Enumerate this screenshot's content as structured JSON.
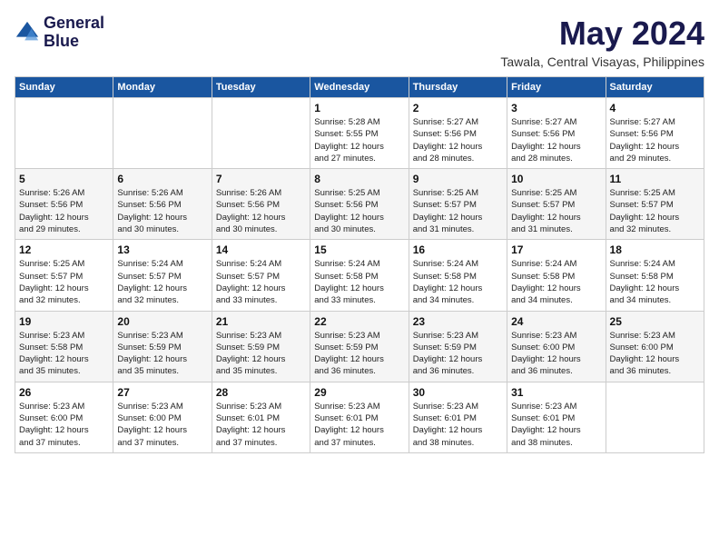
{
  "header": {
    "logo_line1": "General",
    "logo_line2": "Blue",
    "month": "May 2024",
    "location": "Tawala, Central Visayas, Philippines"
  },
  "weekdays": [
    "Sunday",
    "Monday",
    "Tuesday",
    "Wednesday",
    "Thursday",
    "Friday",
    "Saturday"
  ],
  "weeks": [
    [
      {
        "day": "",
        "content": ""
      },
      {
        "day": "",
        "content": ""
      },
      {
        "day": "",
        "content": ""
      },
      {
        "day": "1",
        "content": "Sunrise: 5:28 AM\nSunset: 5:55 PM\nDaylight: 12 hours\nand 27 minutes."
      },
      {
        "day": "2",
        "content": "Sunrise: 5:27 AM\nSunset: 5:56 PM\nDaylight: 12 hours\nand 28 minutes."
      },
      {
        "day": "3",
        "content": "Sunrise: 5:27 AM\nSunset: 5:56 PM\nDaylight: 12 hours\nand 28 minutes."
      },
      {
        "day": "4",
        "content": "Sunrise: 5:27 AM\nSunset: 5:56 PM\nDaylight: 12 hours\nand 29 minutes."
      }
    ],
    [
      {
        "day": "5",
        "content": "Sunrise: 5:26 AM\nSunset: 5:56 PM\nDaylight: 12 hours\nand 29 minutes."
      },
      {
        "day": "6",
        "content": "Sunrise: 5:26 AM\nSunset: 5:56 PM\nDaylight: 12 hours\nand 30 minutes."
      },
      {
        "day": "7",
        "content": "Sunrise: 5:26 AM\nSunset: 5:56 PM\nDaylight: 12 hours\nand 30 minutes."
      },
      {
        "day": "8",
        "content": "Sunrise: 5:25 AM\nSunset: 5:56 PM\nDaylight: 12 hours\nand 30 minutes."
      },
      {
        "day": "9",
        "content": "Sunrise: 5:25 AM\nSunset: 5:57 PM\nDaylight: 12 hours\nand 31 minutes."
      },
      {
        "day": "10",
        "content": "Sunrise: 5:25 AM\nSunset: 5:57 PM\nDaylight: 12 hours\nand 31 minutes."
      },
      {
        "day": "11",
        "content": "Sunrise: 5:25 AM\nSunset: 5:57 PM\nDaylight: 12 hours\nand 32 minutes."
      }
    ],
    [
      {
        "day": "12",
        "content": "Sunrise: 5:25 AM\nSunset: 5:57 PM\nDaylight: 12 hours\nand 32 minutes."
      },
      {
        "day": "13",
        "content": "Sunrise: 5:24 AM\nSunset: 5:57 PM\nDaylight: 12 hours\nand 32 minutes."
      },
      {
        "day": "14",
        "content": "Sunrise: 5:24 AM\nSunset: 5:57 PM\nDaylight: 12 hours\nand 33 minutes."
      },
      {
        "day": "15",
        "content": "Sunrise: 5:24 AM\nSunset: 5:58 PM\nDaylight: 12 hours\nand 33 minutes."
      },
      {
        "day": "16",
        "content": "Sunrise: 5:24 AM\nSunset: 5:58 PM\nDaylight: 12 hours\nand 34 minutes."
      },
      {
        "day": "17",
        "content": "Sunrise: 5:24 AM\nSunset: 5:58 PM\nDaylight: 12 hours\nand 34 minutes."
      },
      {
        "day": "18",
        "content": "Sunrise: 5:24 AM\nSunset: 5:58 PM\nDaylight: 12 hours\nand 34 minutes."
      }
    ],
    [
      {
        "day": "19",
        "content": "Sunrise: 5:23 AM\nSunset: 5:58 PM\nDaylight: 12 hours\nand 35 minutes."
      },
      {
        "day": "20",
        "content": "Sunrise: 5:23 AM\nSunset: 5:59 PM\nDaylight: 12 hours\nand 35 minutes."
      },
      {
        "day": "21",
        "content": "Sunrise: 5:23 AM\nSunset: 5:59 PM\nDaylight: 12 hours\nand 35 minutes."
      },
      {
        "day": "22",
        "content": "Sunrise: 5:23 AM\nSunset: 5:59 PM\nDaylight: 12 hours\nand 36 minutes."
      },
      {
        "day": "23",
        "content": "Sunrise: 5:23 AM\nSunset: 5:59 PM\nDaylight: 12 hours\nand 36 minutes."
      },
      {
        "day": "24",
        "content": "Sunrise: 5:23 AM\nSunset: 6:00 PM\nDaylight: 12 hours\nand 36 minutes."
      },
      {
        "day": "25",
        "content": "Sunrise: 5:23 AM\nSunset: 6:00 PM\nDaylight: 12 hours\nand 36 minutes."
      }
    ],
    [
      {
        "day": "26",
        "content": "Sunrise: 5:23 AM\nSunset: 6:00 PM\nDaylight: 12 hours\nand 37 minutes."
      },
      {
        "day": "27",
        "content": "Sunrise: 5:23 AM\nSunset: 6:00 PM\nDaylight: 12 hours\nand 37 minutes."
      },
      {
        "day": "28",
        "content": "Sunrise: 5:23 AM\nSunset: 6:01 PM\nDaylight: 12 hours\nand 37 minutes."
      },
      {
        "day": "29",
        "content": "Sunrise: 5:23 AM\nSunset: 6:01 PM\nDaylight: 12 hours\nand 37 minutes."
      },
      {
        "day": "30",
        "content": "Sunrise: 5:23 AM\nSunset: 6:01 PM\nDaylight: 12 hours\nand 38 minutes."
      },
      {
        "day": "31",
        "content": "Sunrise: 5:23 AM\nSunset: 6:01 PM\nDaylight: 12 hours\nand 38 minutes."
      },
      {
        "day": "",
        "content": ""
      }
    ]
  ]
}
